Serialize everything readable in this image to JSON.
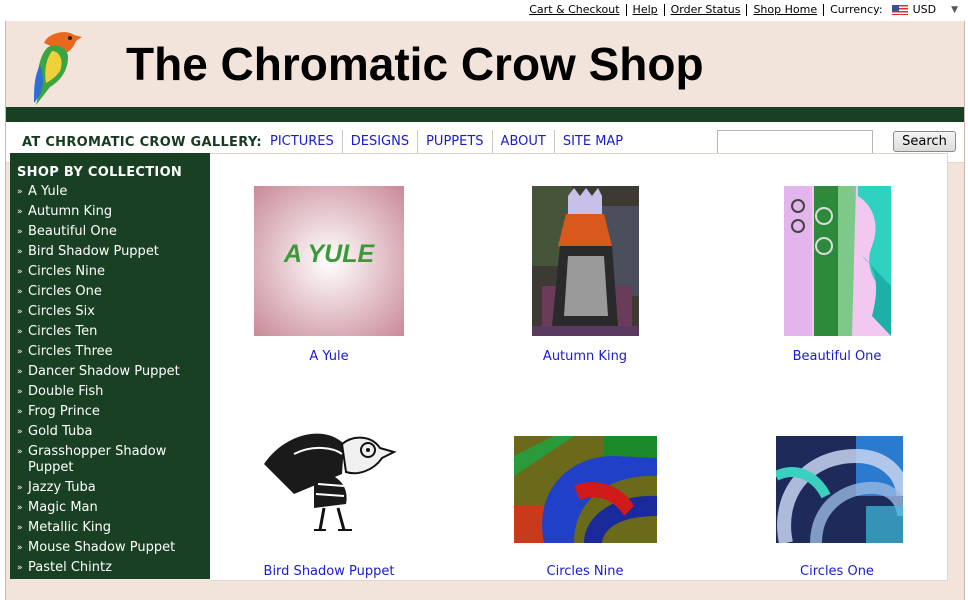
{
  "topbar": {
    "cart": "Cart & Checkout",
    "help": "Help",
    "order_status": "Order Status",
    "shop_home": "Shop Home",
    "currency_label": "Currency:",
    "currency_value": "USD"
  },
  "header": {
    "title": "The Chromatic Crow Shop"
  },
  "nav": {
    "label": "AT CHROMATIC CROW GALLERY:",
    "links": [
      "PICTURES",
      "DESIGNS",
      "PUPPETS",
      "ABOUT",
      "SITE MAP"
    ],
    "search_value": "",
    "search_button": "Search"
  },
  "sidebar": {
    "heading": "SHOP BY COLLECTION",
    "items": [
      "A Yule",
      "Autumn King",
      "Beautiful One",
      "Bird Shadow Puppet",
      "Circles Nine",
      "Circles One",
      "Circles Six",
      "Circles Ten",
      "Circles Three",
      "Dancer Shadow Puppet",
      "Double Fish",
      "Frog Prince",
      "Gold Tuba",
      "Grasshopper Shadow Puppet",
      "Jazzy Tuba",
      "Magic Man",
      "Metallic King",
      "Mouse Shadow Puppet",
      "Pastel Chintz"
    ]
  },
  "products": [
    {
      "name": "A Yule",
      "image_text": "A YULE"
    },
    {
      "name": "Autumn King"
    },
    {
      "name": "Beautiful One"
    },
    {
      "name": "Bird Shadow Puppet"
    },
    {
      "name": "Circles Nine"
    },
    {
      "name": "Circles One"
    }
  ],
  "colors": {
    "frame_bg": "#f3e4db",
    "brand_green": "#1a4023",
    "link_blue": "#1a1ad0"
  }
}
